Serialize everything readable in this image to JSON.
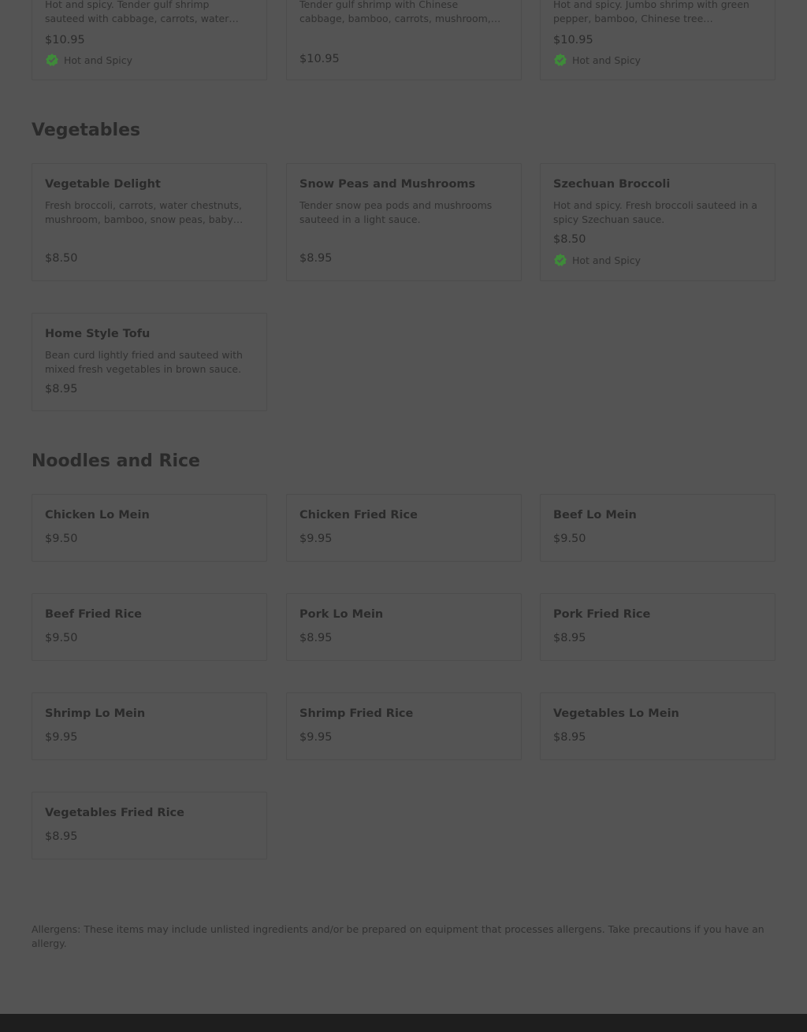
{
  "top_cards": [
    {
      "description": "Hot and spicy. Tender gulf shrimp sauteed with cabbage, carrots, water chestnuts, mushroom",
      "price": "$10.95",
      "tag": "Hot and Spicy"
    },
    {
      "description": "Tender gulf shrimp with Chinese cabbage, bamboo, carrots, mushroom, snow peas and baby corn",
      "price": "$10.95"
    },
    {
      "description": "Hot and spicy. Jumbo shrimp with green pepper, bamboo, Chinese tree mushrooms and carrots",
      "price": "$10.95",
      "tag": "Hot and Spicy"
    }
  ],
  "sections": {
    "vegetables": {
      "title": "Vegetables",
      "items": [
        {
          "name": "Vegetable Delight",
          "description": "Fresh broccoli, carrots, water chestnuts, mushroom, bamboo, snow peas, baby corn and cabbage",
          "price": "$8.50"
        },
        {
          "name": "Snow Peas and Mushrooms",
          "description": "Tender snow pea pods and mushrooms sauteed in a light sauce.",
          "price": "$8.95"
        },
        {
          "name": "Szechuan Broccoli",
          "description": "Hot and spicy. Fresh broccoli sauteed in a spicy Szechuan sauce.",
          "price": "$8.50",
          "tag": "Hot and Spicy"
        },
        {
          "name": "Home Style Tofu",
          "description": "Bean curd lightly fried and sauteed with mixed fresh vegetables in brown sauce.",
          "price": "$8.95"
        }
      ]
    },
    "noodles": {
      "title": "Noodles and Rice",
      "items": [
        {
          "name": "Chicken Lo Mein",
          "price": "$9.50"
        },
        {
          "name": "Chicken Fried Rice",
          "price": "$9.95"
        },
        {
          "name": "Beef Lo Mein",
          "price": "$9.50"
        },
        {
          "name": "Beef Fried Rice",
          "price": "$9.50"
        },
        {
          "name": "Pork Lo Mein",
          "price": "$8.95"
        },
        {
          "name": "Pork Fried Rice",
          "price": "$8.95"
        },
        {
          "name": "Shrimp Lo Mein",
          "price": "$9.95"
        },
        {
          "name": "Shrimp Fried Rice",
          "price": "$9.95"
        },
        {
          "name": "Vegetables Lo Mein",
          "price": "$8.95"
        },
        {
          "name": "Vegetables Fried Rice",
          "price": "$8.95"
        }
      ]
    }
  },
  "allergen_note": "Allergens: These items may include unlisted ingredients and/or be prepared on equipment that processes allergens. Take precautions if you have an allergy.",
  "colors": {
    "overlay_background": "#545454",
    "tag_icon": "#3f8a3a",
    "footer_bar": "#1e1e1e"
  },
  "icons": {
    "hot_and_spicy": "check-badge-icon"
  }
}
